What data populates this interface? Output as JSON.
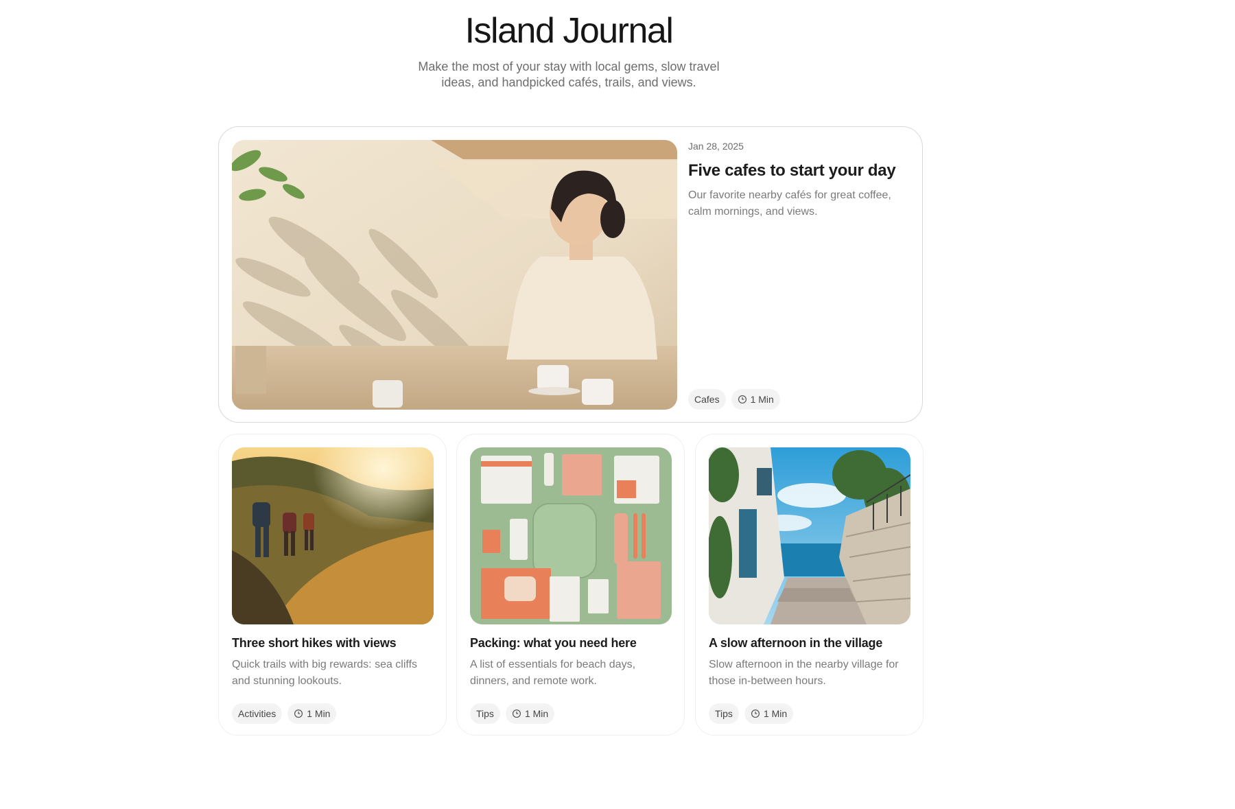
{
  "header": {
    "title": "Island Journal",
    "subtitle": "Make the most of your stay with local gems, slow travel ideas, and handpicked cafés, trails, and views."
  },
  "featured": {
    "date": "Jan 28, 2025",
    "title": "Five cafes to start your day",
    "excerpt": "Our favorite nearby cafés for great coffee, calm mornings, and views.",
    "category": "Cafes",
    "read_time": "1 Min"
  },
  "cards": [
    {
      "title": "Three short hikes with views",
      "excerpt": "Quick trails with big rewards: sea cliffs and stunning lookouts.",
      "category": "Activities",
      "read_time": "1 Min"
    },
    {
      "title": "Packing: what you need here",
      "excerpt": "A list of essentials for beach days, dinners, and remote work.",
      "category": "Tips",
      "read_time": "1 Min"
    },
    {
      "title": "A slow afternoon in the village",
      "excerpt": "Slow afternoon in the nearby village for those in-between hours.",
      "category": "Tips",
      "read_time": "1 Min"
    }
  ],
  "icons": {
    "read_time": "clock-icon"
  },
  "colors": {
    "title": "#161616",
    "muted_text": "#7a7a7a",
    "tag_background": "#f3f3f3",
    "card_border": "#d9d9d9"
  }
}
